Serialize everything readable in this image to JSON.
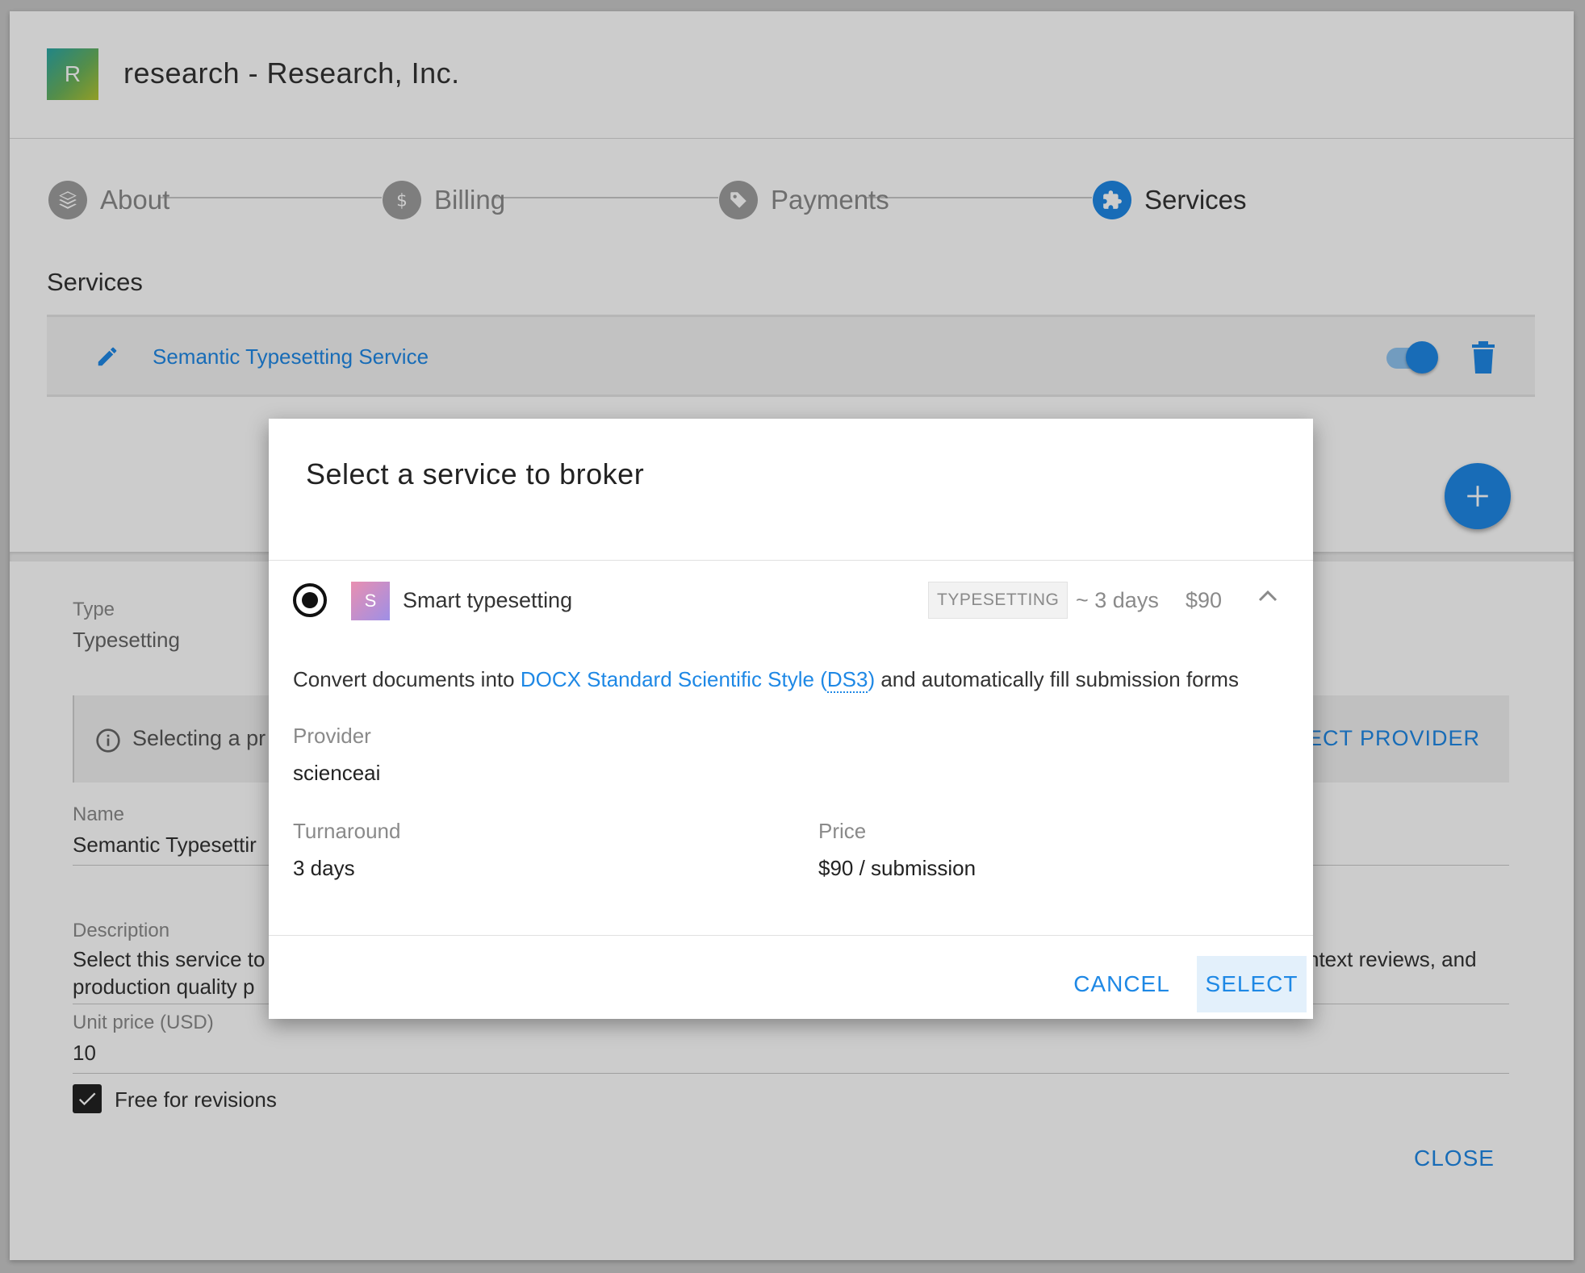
{
  "org": {
    "avatar_letter": "R",
    "title": "research - Research, Inc."
  },
  "stepper": {
    "steps": [
      {
        "label": "About",
        "icon": "layers-icon",
        "active": false
      },
      {
        "label": "Billing",
        "icon": "dollar-icon",
        "active": false
      },
      {
        "label": "Payments",
        "icon": "tag-icon",
        "active": false
      },
      {
        "label": "Services",
        "icon": "puzzle-icon",
        "active": true
      }
    ]
  },
  "services": {
    "heading": "Services",
    "items": [
      {
        "name": "Semantic Typesetting Service",
        "enabled": true
      }
    ]
  },
  "form": {
    "type_label": "Type",
    "type_value": "Typesetting",
    "info_text": "Selecting a pr",
    "info_action": "LECT PROVIDER",
    "name_label": "Name",
    "name_value": "Semantic Typesettir",
    "description_label": "Description",
    "description_line1": "Select this service to",
    "description_line1_end": "ntext reviews, and",
    "description_line2": "production quality p",
    "unit_price_label": "Unit price (USD)",
    "unit_price_value": "10",
    "free_revisions_label": "Free for revisions",
    "free_revisions_checked": true,
    "close_label": "CLOSE"
  },
  "dialog": {
    "title": "Select a service to broker",
    "option": {
      "avatar_letter": "S",
      "name": "Smart typesetting",
      "tag": "TYPESETTING",
      "turnaround_short": "~ 3 days",
      "price_short": "$90",
      "selected": true,
      "expanded": true,
      "desc_prefix": "Convert documents into ",
      "desc_link": "DOCX Standard Scientific Style (",
      "desc_abbr": "DS3",
      "desc_link_end": ")",
      "desc_suffix": " and automatically fill submission forms",
      "provider_label": "Provider",
      "provider_value": "scienceai",
      "turnaround_label": "Turnaround",
      "turnaround_value": "3 days",
      "price_label": "Price",
      "price_value": "$90 / submission"
    },
    "cancel_label": "CANCEL",
    "select_label": "SELECT"
  },
  "colors": {
    "accent": "#1e88e5",
    "overlay": "rgba(0,0,0,0.2)"
  }
}
